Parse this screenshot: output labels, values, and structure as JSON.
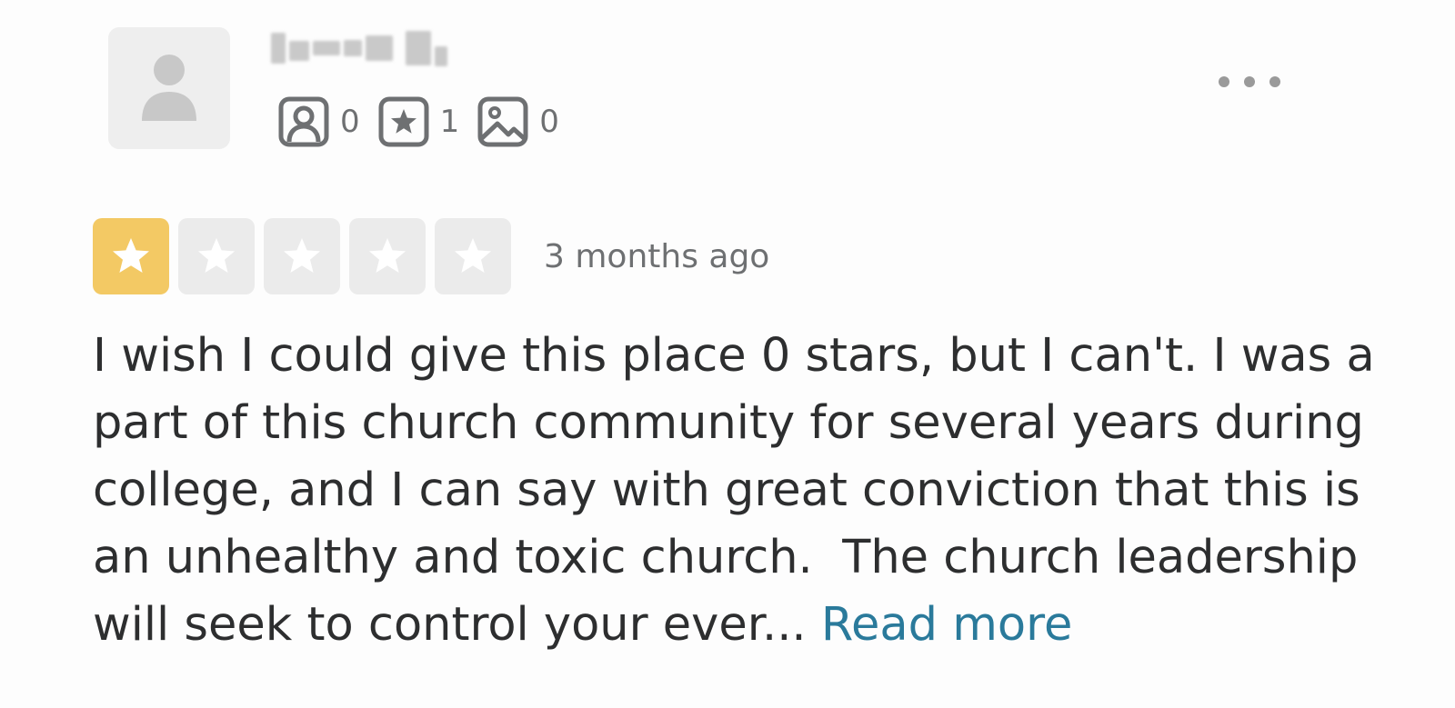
{
  "user": {
    "name": "",
    "avatar_icon": "person-silhouette-icon",
    "stats": [
      {
        "icon": "friends-icon",
        "value": "0"
      },
      {
        "icon": "reviews-star-icon",
        "value": "1"
      },
      {
        "icon": "photos-icon",
        "value": "0"
      }
    ]
  },
  "menu": {
    "icon": "more-options-icon"
  },
  "rating": {
    "value": 1,
    "max": 5,
    "filled_color": "#f3c964",
    "empty_color": "#ebebeb"
  },
  "review": {
    "date": "3 months ago",
    "text": "I wish I could give this place 0 stars, but I can't. I was a part of this church community for several years during college, and I can say with great conviction that this is an unhealthy and toxic church.  The church leadership will seek to control your ever...",
    "read_more_label": "Read more",
    "link_color": "#2a7a9b"
  }
}
